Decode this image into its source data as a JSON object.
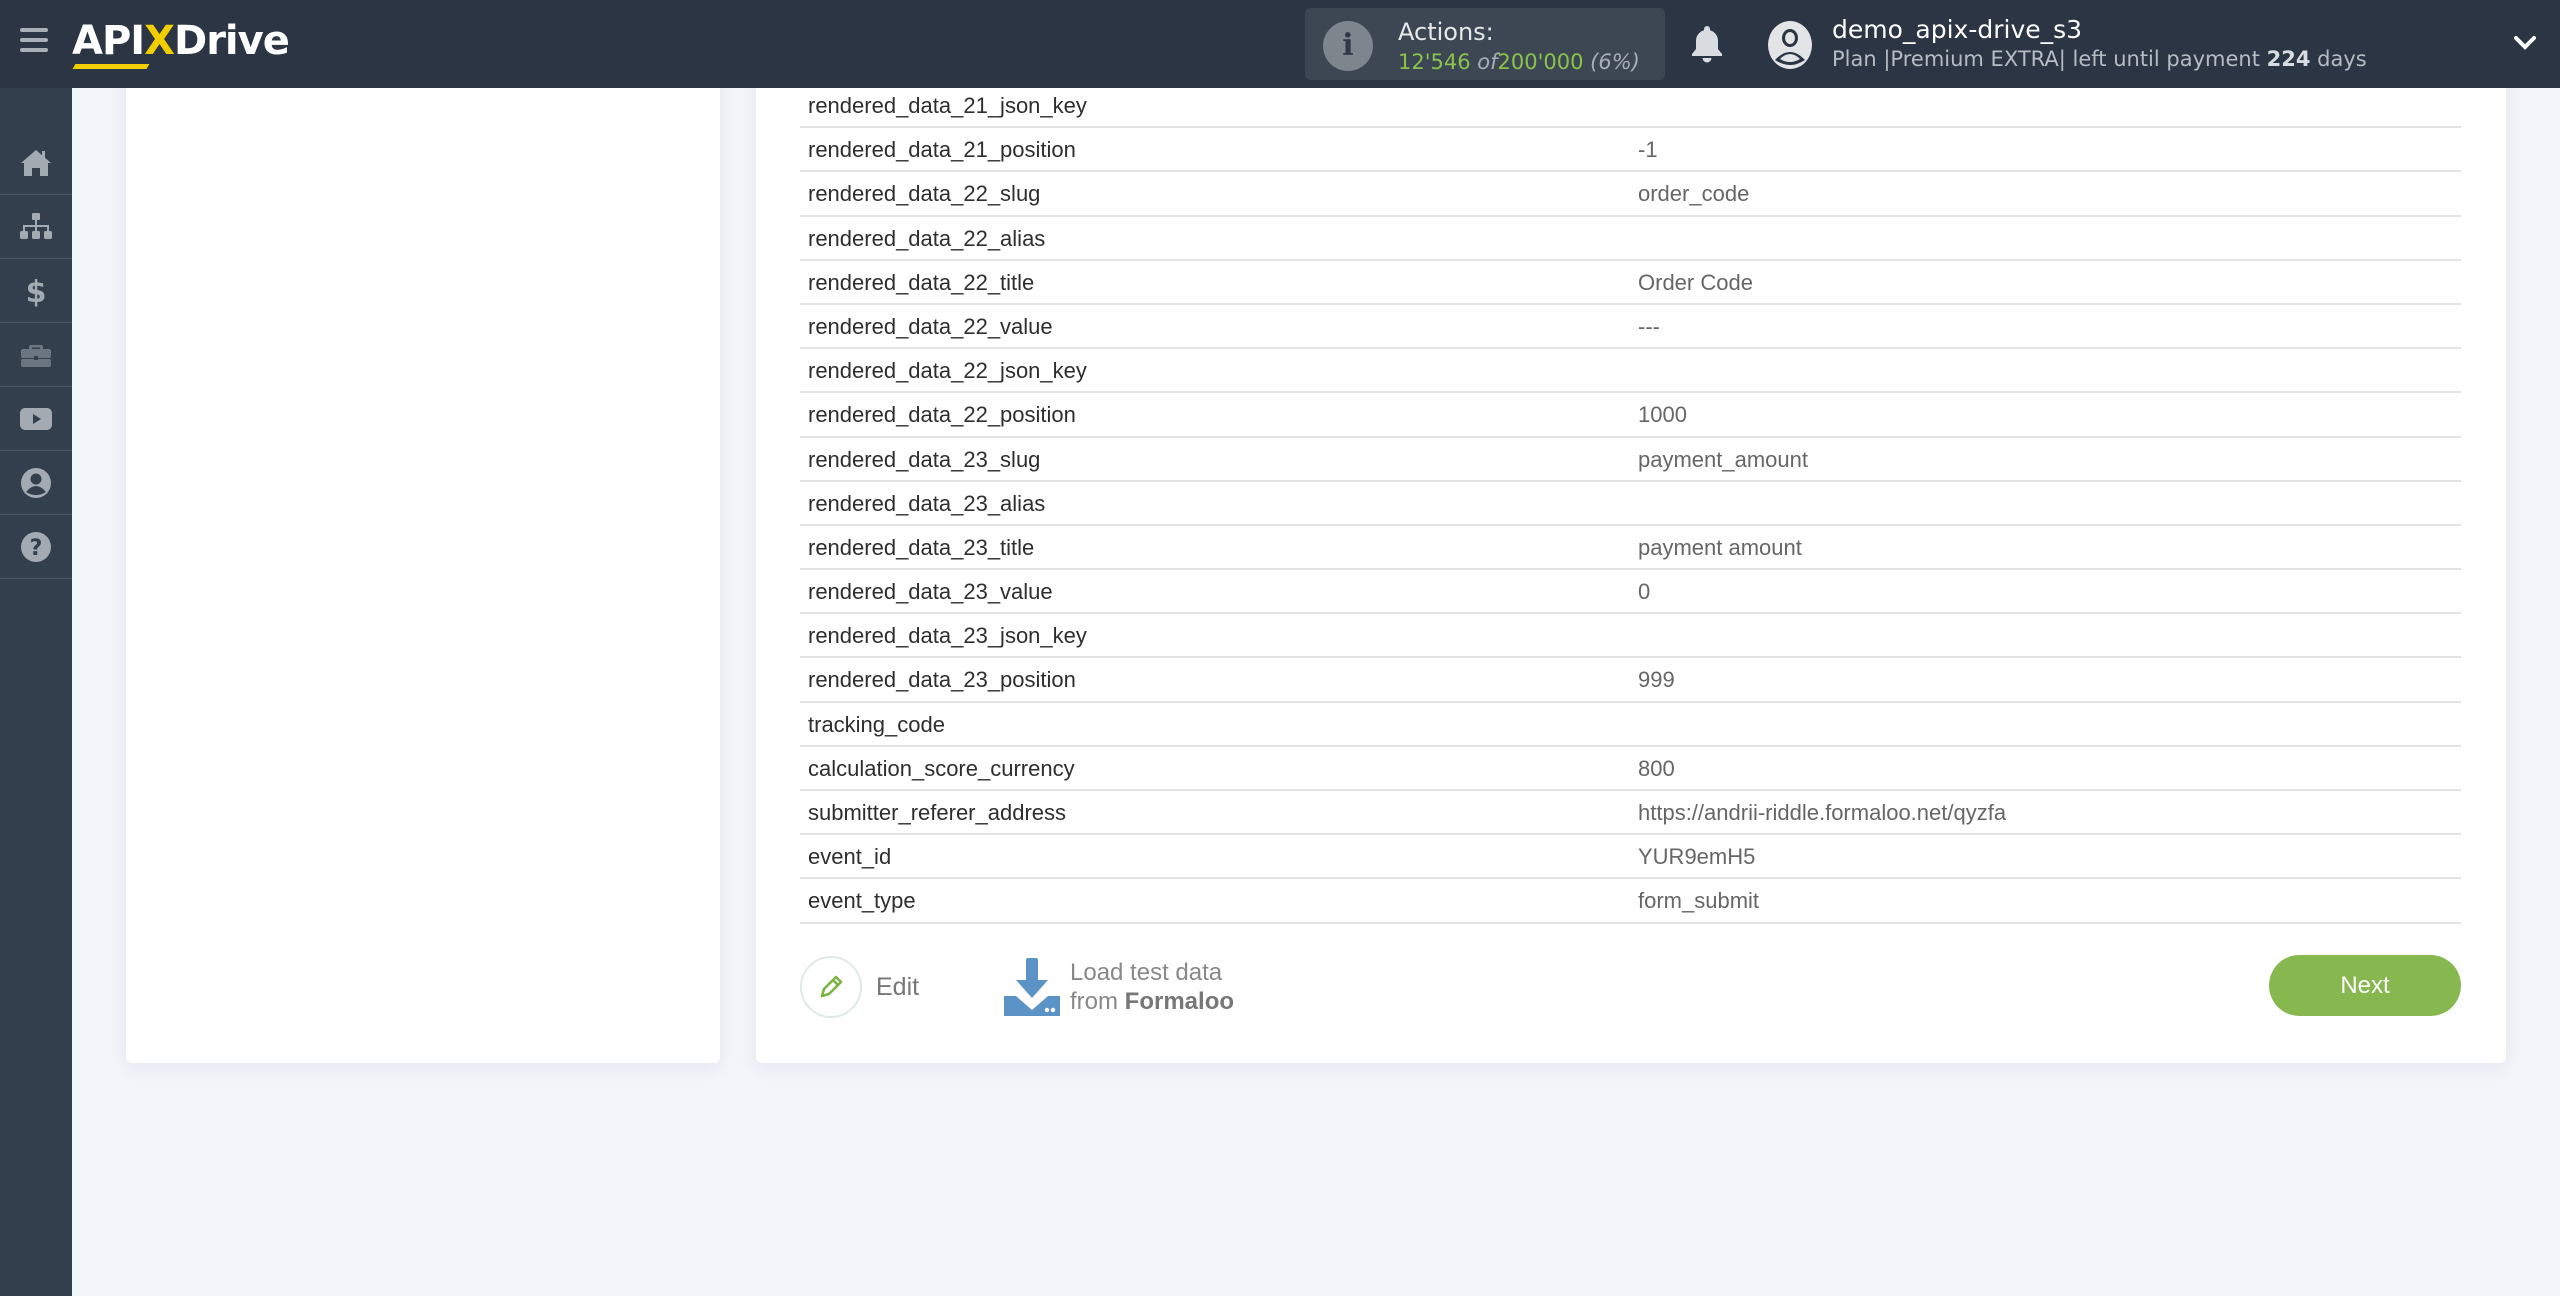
{
  "header": {
    "menu_icon": "hamburger-menu-icon",
    "logo": {
      "part1": "API",
      "x": "X",
      "part2": "Drive"
    },
    "actions": {
      "label": "Actions:",
      "used": "12'546",
      "of": "of",
      "total": "200'000",
      "percent": "(6%)",
      "used_fraction": 0.06
    },
    "notifications_icon": "bell-icon",
    "user": {
      "name": "demo_apix-drive_s3",
      "plan_prefix": "Plan |Premium EXTRA| left until payment",
      "days": "224",
      "days_suffix": "days"
    }
  },
  "sidebar": {
    "items": [
      {
        "name": "home",
        "icon": "home-icon"
      },
      {
        "name": "connections",
        "icon": "sitemap-icon"
      },
      {
        "name": "billing",
        "icon": "dollar-icon"
      },
      {
        "name": "services",
        "icon": "briefcase-icon"
      },
      {
        "name": "video",
        "icon": "youtube-icon"
      },
      {
        "name": "account",
        "icon": "user-circle-icon"
      },
      {
        "name": "help",
        "icon": "question-circle-icon"
      }
    ]
  },
  "table": {
    "rows": [
      {
        "key": "rendered_data_21_json_key",
        "value": ""
      },
      {
        "key": "rendered_data_21_position",
        "value": "-1"
      },
      {
        "key": "rendered_data_22_slug",
        "value": "order_code"
      },
      {
        "key": "rendered_data_22_alias",
        "value": ""
      },
      {
        "key": "rendered_data_22_title",
        "value": "Order Code"
      },
      {
        "key": "rendered_data_22_value",
        "value": "---"
      },
      {
        "key": "rendered_data_22_json_key",
        "value": ""
      },
      {
        "key": "rendered_data_22_position",
        "value": "1000"
      },
      {
        "key": "rendered_data_23_slug",
        "value": "payment_amount"
      },
      {
        "key": "rendered_data_23_alias",
        "value": ""
      },
      {
        "key": "rendered_data_23_title",
        "value": "payment amount"
      },
      {
        "key": "rendered_data_23_value",
        "value": "0"
      },
      {
        "key": "rendered_data_23_json_key",
        "value": ""
      },
      {
        "key": "rendered_data_23_position",
        "value": "999"
      },
      {
        "key": "tracking_code",
        "value": ""
      },
      {
        "key": "calculation_score_currency",
        "value": "800"
      },
      {
        "key": "submitter_referer_address",
        "value": "https://andrii-riddle.formaloo.net/qyzfa"
      },
      {
        "key": "event_id",
        "value": "YUR9emH5"
      },
      {
        "key": "event_type",
        "value": "form_submit"
      }
    ]
  },
  "actions_bar": {
    "edit_label": "Edit",
    "load_line1": "Load test data",
    "load_line2_prefix": "from",
    "load_source": "Formaloo",
    "next_label": "Next"
  },
  "colors": {
    "header_bg": "#2b3543",
    "sidebar_bg": "#343f4d",
    "accent_green": "#86b84f",
    "logo_yellow": "#f2cd00",
    "download_blue": "#5b93c7"
  }
}
